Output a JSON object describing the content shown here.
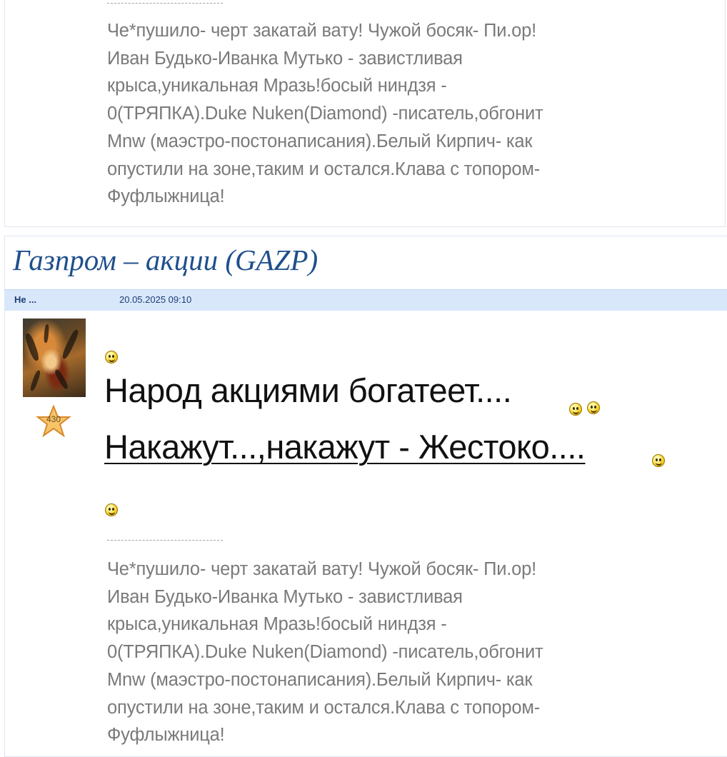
{
  "top_post": {
    "signature_lines": [
      "Че*пушило- черт закатай вату! Чужой босяк- Пи.ор!",
      "Иван Будько-Иванка Мутько - завистливая",
      "крыса,уникальная Мразь!босый ниндзя -",
      "0(ТРЯПКА).Duke Nuken(Diamond) -писатель,обгонит",
      "Mnw (маэстро-постонаписания).Белый Кирпич- как",
      "опустили на зоне,таким и остался.Клава с топором-",
      "Фуфлыжница!"
    ]
  },
  "thread": {
    "title": "Газпром – акции (GAZP)"
  },
  "post": {
    "author": "Не ...",
    "timestamp": "20.05.2025 09:10",
    "rating": "430",
    "message_line1": "Народ акциями богатеет....",
    "message_line2": "Накажут...,накажут - Жестоко....",
    "signature_lines": [
      "Че*пушило- черт закатай вату! Чужой босяк- Пи.ор!",
      "Иван Будько-Иванка Мутько - завистливая",
      "крыса,уникальная Мразь!босый ниндзя -",
      "0(ТРЯПКА).Duke Nuken(Diamond) -писатель,обгонит",
      "Mnw (маэстро-постонаписания).Белый Кирпич- как",
      "опустили на зоне,таким и остался.Клава с топором-",
      "Фуфлыжница!"
    ]
  },
  "colors": {
    "title": "#1f4f8c",
    "header_bg": "#d9e7fb",
    "signature_text": "#7a7a7a"
  },
  "icons": {
    "smiley": "smiley-icon",
    "wink": "wink-smiley-icon",
    "rating_star": "star-icon"
  }
}
